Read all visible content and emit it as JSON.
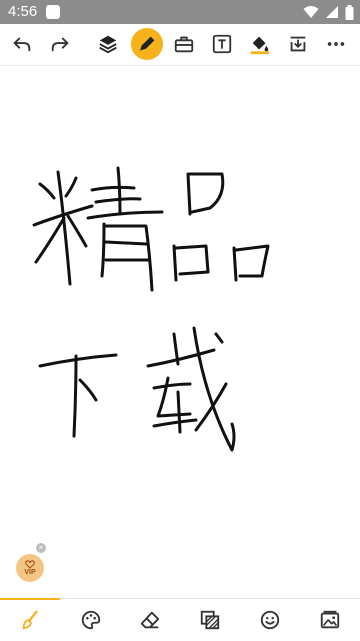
{
  "status_bar": {
    "time": "4:56",
    "icons": [
      "notification-icon",
      "wifi-icon",
      "signal-icon",
      "battery-icon"
    ]
  },
  "toolbar": {
    "items": [
      {
        "name": "undo-icon"
      },
      {
        "name": "redo-icon"
      },
      {
        "name": "layers-icon"
      },
      {
        "name": "pen-icon",
        "active": true
      },
      {
        "name": "toolbox-icon"
      },
      {
        "name": "text-icon"
      },
      {
        "name": "fill-bucket-icon"
      },
      {
        "name": "save-download-icon"
      },
      {
        "name": "more-icon"
      }
    ],
    "accent_color": "#f6b21b"
  },
  "canvas": {
    "background": "#ffffff",
    "stroke_color": "#111111",
    "handwritten_text": [
      "精品",
      "下载"
    ]
  },
  "vip_badge": {
    "label": "VIP",
    "color": "#f3c585"
  },
  "bottom_bar": {
    "items": [
      {
        "name": "brush-icon",
        "active": true
      },
      {
        "name": "palette-icon"
      },
      {
        "name": "eraser-icon"
      },
      {
        "name": "background-pattern-icon"
      },
      {
        "name": "sticker-smiley-icon"
      },
      {
        "name": "gallery-image-icon"
      }
    ]
  }
}
